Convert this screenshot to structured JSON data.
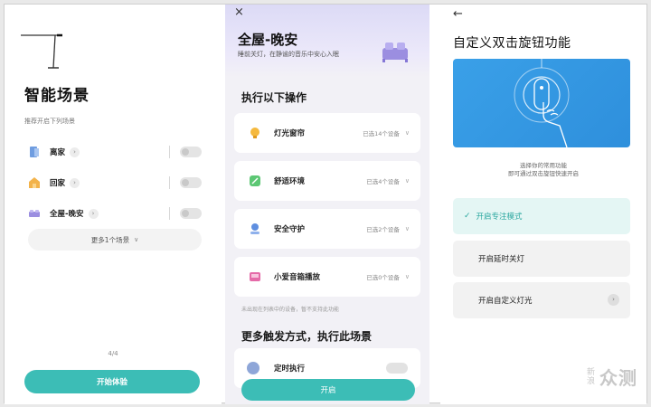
{
  "panel1": {
    "title": "智能场景",
    "subtitle": "推荐开启下列场景",
    "scenes": [
      {
        "label": "离家",
        "arrow": "›"
      },
      {
        "label": "回家",
        "arrow": "›"
      },
      {
        "label": "全屋-晚安",
        "arrow": "›"
      }
    ],
    "more_label": "更多1个场景",
    "more_chevron": "∨",
    "page_indicator": "4/4",
    "start_button": "开始体验"
  },
  "panel2": {
    "close_glyph": "×",
    "title": "全屋-晚安",
    "description": "睡前关灯，在静谧的音乐中安心入眠",
    "section_title": "执行以下操作",
    "operations": [
      {
        "label": "灯光窗帘",
        "value": "已选14个设备",
        "chevron": "∨"
      },
      {
        "label": "舒适环境",
        "value": "已选4个设备",
        "chevron": "∨"
      },
      {
        "label": "安全守护",
        "value": "已选2个设备",
        "chevron": "∨"
      },
      {
        "label": "小爱音箱播放",
        "value": "已选0个设备",
        "chevron": "∨"
      }
    ],
    "note": "未出现在列表中的设备，暂不支持此功能",
    "section2_title": "更多触发方式，执行此场景",
    "timer_label": "定时执行",
    "open_button": "开启"
  },
  "panel3": {
    "back_glyph": "←",
    "title": "自定义双击旋钮功能",
    "desc_line1": "选择你的常用功能",
    "desc_line2": "即可通过双击旋钮快速开启",
    "options": [
      {
        "label": "开启专注模式",
        "selected": true,
        "check": "✓"
      },
      {
        "label": "开启延时关灯",
        "selected": false
      },
      {
        "label": "开启自定义灯光",
        "selected": false,
        "arrow": "›"
      }
    ]
  },
  "watermark": {
    "small": "新浪",
    "big": "众测"
  },
  "colors": {
    "accent": "#3cbdb6",
    "illustration_blue": "#3aa0e8",
    "selected_bg": "#e4f6f4"
  },
  "icons": [
    "lamp-icon",
    "leave-home-icon",
    "home-icon",
    "bed-icon",
    "bulb-icon",
    "leaf-icon",
    "security-icon",
    "speaker-icon",
    "clock-icon",
    "knob-illustration"
  ]
}
